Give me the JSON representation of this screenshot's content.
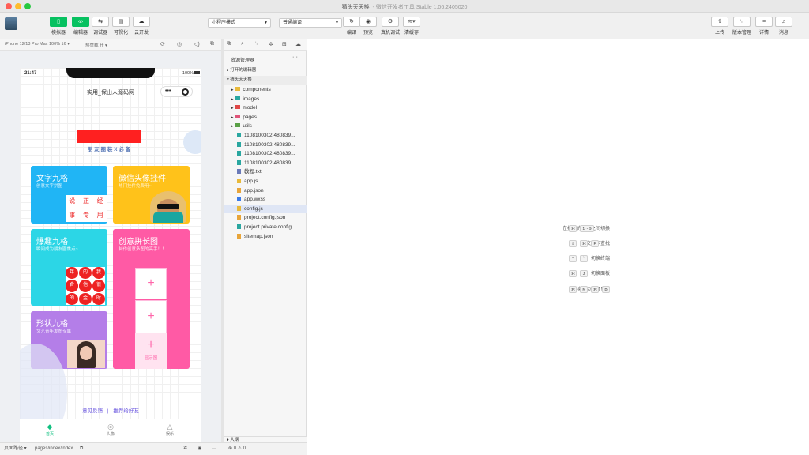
{
  "window": {
    "title": "猜头天天换",
    "subtitle": "- 微信开发者工具 Stable 1.06.2405020"
  },
  "toolbar": {
    "left": [
      {
        "label": "模拟器",
        "icon": "phone-icon"
      },
      {
        "label": "编辑器",
        "icon": "code-icon"
      },
      {
        "label": "调试器",
        "icon": "debug-icon"
      },
      {
        "label": "可视化",
        "icon": "visual-icon"
      },
      {
        "label": "云开发",
        "icon": "cloud-icon"
      }
    ],
    "mode_select": "小程序模式",
    "compile_select": "普通编译",
    "mid": [
      {
        "label": "编译"
      },
      {
        "label": "预览"
      },
      {
        "label": "真机调试"
      },
      {
        "label": "清缓存"
      }
    ],
    "right": [
      {
        "label": "上传"
      },
      {
        "label": "版本管理"
      },
      {
        "label": "详情"
      },
      {
        "label": "消息"
      }
    ]
  },
  "simulator": {
    "device": "iPhone 12/13 Pro Max 100% 16 ▾",
    "hot_reload": "热重载 开 ▾"
  },
  "phone": {
    "time": "21:47",
    "battery": "100%",
    "nav_title": "实用_保山人源码网",
    "banner_sub": "朋 友 圈 装 X 必 备",
    "cards": [
      {
        "title": "文字九格",
        "sub": "创意文字拼图"
      },
      {
        "title": "微信头像挂件",
        "sub": "热门挂件免费用~"
      },
      {
        "title": "爆趣九格",
        "sub": "瞬间成为朋友圈焦点~"
      },
      {
        "title": "创意拼长图",
        "sub": "制作创意多图的高手！！"
      },
      {
        "title": "形状九格",
        "sub": "文艺青年发图专属"
      }
    ],
    "grid_chars": [
      "说",
      "正",
      "经",
      "事",
      "专",
      "用"
    ],
    "emoji_chars": [
      "年",
      "的",
      "我",
      "合",
      "他",
      "很",
      "的",
      "金",
      "时"
    ],
    "long_tip": "显示图",
    "footer": {
      "feedback": "意见反馈",
      "sep": "|",
      "recommend": "推荐给好友"
    },
    "tabs": [
      {
        "label": "首页"
      },
      {
        "label": "头像"
      },
      {
        "label": "娱乐"
      }
    ]
  },
  "explorer": {
    "header": "资源管理器",
    "more": "···",
    "open_editors": "打开的编辑器",
    "project": "猜头天天换",
    "folders": [
      "components",
      "images",
      "model",
      "pages",
      "utils"
    ],
    "files": [
      "1108100302.480839...",
      "1108100302.480839...",
      "1108100302.480839...",
      "1108100302.480839...",
      "教程.txt",
      "app.js",
      "app.json",
      "app.wxss",
      "config.js",
      "project.config.json",
      "project.private.config...",
      "sitemap.json"
    ],
    "outline": "大纲"
  },
  "shortcuts": [
    {
      "label": "在打开的文件之间切换",
      "keys": [
        "⌘",
        "1 ~ 9"
      ]
    },
    {
      "label": "在文件中查找",
      "keys": [
        "⇧",
        "⌘",
        "F"
      ]
    },
    {
      "label": "切换终端",
      "keys": [
        "^",
        "`"
      ]
    },
    {
      "label": "切换面板",
      "keys": [
        "⌘",
        "J"
      ]
    },
    {
      "label": "切换侧边栏可见性",
      "keys": [
        "⌘",
        "K",
        "⌘",
        "B"
      ]
    }
  ],
  "status": {
    "path_label": "页面路径 ▾",
    "path": "pages/index/index",
    "errors": "⊗ 0 ⚠ 0"
  }
}
